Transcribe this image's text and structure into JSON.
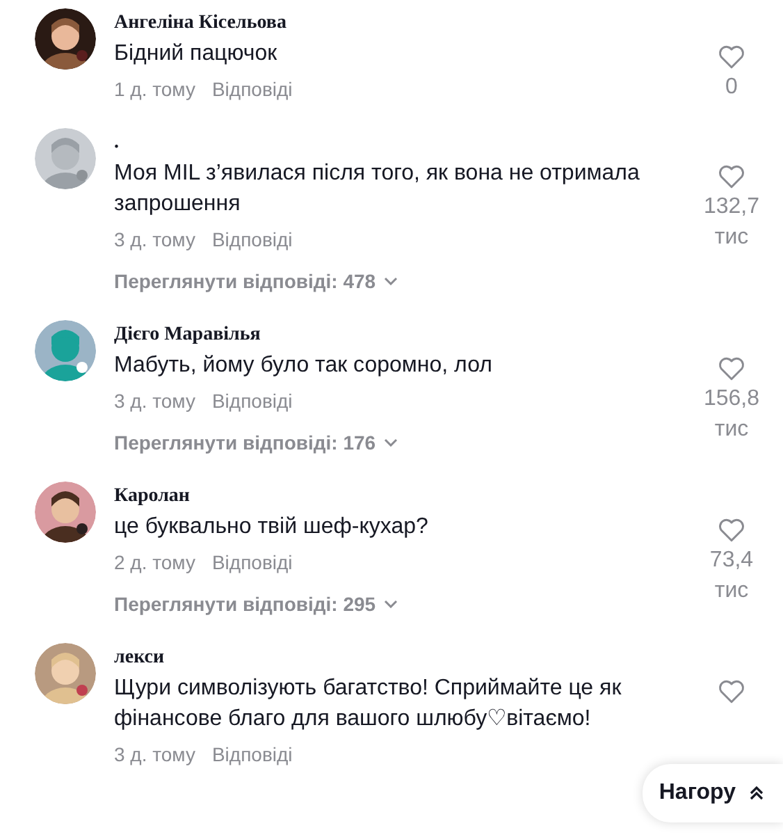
{
  "comments": [
    {
      "author": "Ангеліна Кісельова",
      "text": "Бідний пацючок",
      "time": "1 д. тому",
      "reply": "Відповіді",
      "likes": "0"
    },
    {
      "author": ".",
      "text": "Моя MIL з’явилася після того, як вона не отримала запрошення",
      "time": "3 д. тому",
      "reply": "Відповіді",
      "likes": "132,7 тис",
      "view_replies": "Переглянути відповіді: 478"
    },
    {
      "author": "Дієго Маравілья",
      "text": "Мабуть, йому було так соромно, лол",
      "time": "3 д. тому",
      "reply": "Відповіді",
      "likes": "156,8 тис",
      "view_replies": "Переглянути відповіді: 176"
    },
    {
      "author": "Каролан",
      "text": "це буквально твій шеф-кухар?",
      "time": "2 д. тому",
      "reply": "Відповіді",
      "likes": "73,4 тис",
      "view_replies": "Переглянути відповіді: 295"
    },
    {
      "author": "лекси",
      "text": "Щури символізують багатство! Сприймайте це як фінансове благо для вашого шлюбу♡вітаємо!",
      "time": "3 д. тому",
      "reply": "Відповіді"
    }
  ],
  "back_to_top": {
    "label": "Нагору"
  }
}
